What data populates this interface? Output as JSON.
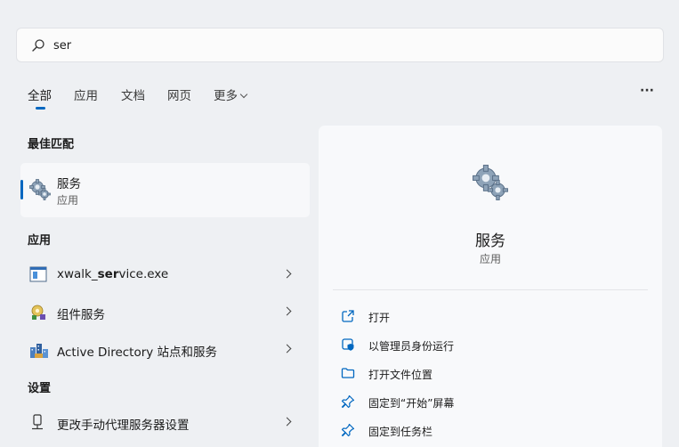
{
  "search": {
    "value": "ser"
  },
  "tabs": [
    {
      "label": "全部",
      "active": true
    },
    {
      "label": "应用"
    },
    {
      "label": "文档"
    },
    {
      "label": "网页"
    },
    {
      "label": "更多"
    }
  ],
  "more_options": "···",
  "sections": {
    "best_match": "最佳匹配",
    "apps": "应用",
    "settings": "设置"
  },
  "best_match": {
    "title": "服务",
    "subtitle": "应用",
    "icon": "services-gear-icon"
  },
  "apps": [
    {
      "label_prefix": "xwalk_",
      "label_bold": "ser",
      "label_suffix": "vice.exe",
      "icon": "exe-window-icon"
    },
    {
      "label": "组件服务",
      "icon": "component-services-icon"
    },
    {
      "label": "Active Directory 站点和服务",
      "icon": "ad-sites-icon"
    }
  ],
  "settings": [
    {
      "label": "更改手动代理服务器设置",
      "icon": "proxy-settings-icon"
    }
  ],
  "details": {
    "title": "服务",
    "subtitle": "应用",
    "actions": [
      {
        "label": "打开",
        "icon": "open-icon"
      },
      {
        "label": "以管理员身份运行",
        "icon": "shield-icon"
      },
      {
        "label": "打开文件位置",
        "icon": "folder-icon"
      },
      {
        "label": "固定到“开始”屏幕",
        "icon": "pin-icon"
      },
      {
        "label": "固定到任务栏",
        "icon": "pin-icon"
      }
    ]
  },
  "colors": {
    "accent": "#0067c0",
    "background": "#eef0f3"
  }
}
